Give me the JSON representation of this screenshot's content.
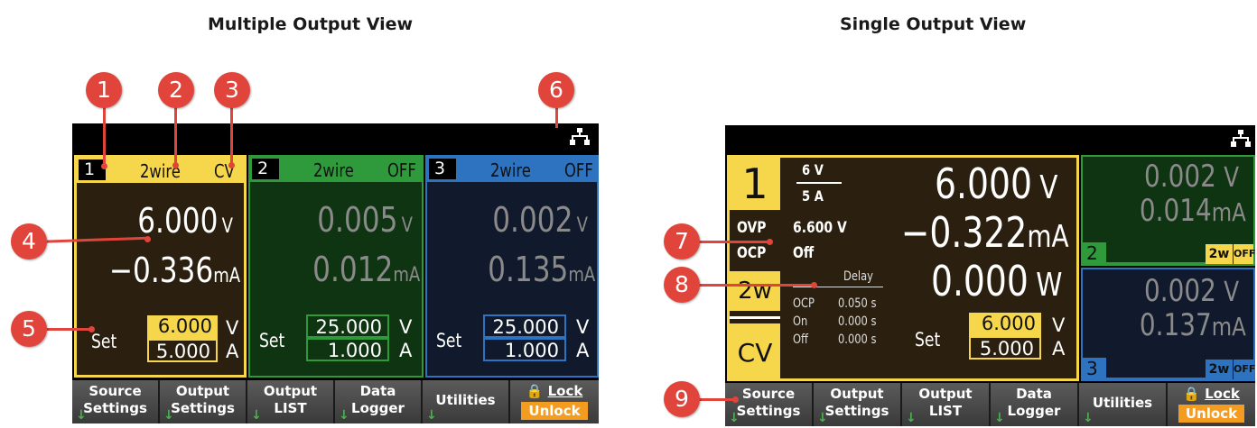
{
  "headings": {
    "multiple": "Multiple Output View",
    "single": "Single Output View"
  },
  "callouts": [
    "1",
    "2",
    "3",
    "4",
    "5",
    "6",
    "7",
    "8",
    "9"
  ],
  "colors": {
    "ch1": "#f6d64a",
    "ch2": "#2f9a3c",
    "ch3": "#2d73c0",
    "callout": "#e0443b"
  },
  "multi": {
    "ch1": {
      "num": "1",
      "wire": "2wire",
      "mode": "CV",
      "voltage": "6.000",
      "vunit": "V",
      "current": "−0.336",
      "iunit": "mA",
      "set_label": "Set",
      "set_v": "6.000",
      "set_a": "5.000",
      "vu": "V",
      "au": "A"
    },
    "ch2": {
      "num": "2",
      "wire": "2wire",
      "mode": "OFF",
      "voltage": "0.005",
      "vunit": "V",
      "current": "0.012",
      "iunit": "mA",
      "set_label": "Set",
      "set_v": "25.000",
      "set_a": "1.000",
      "vu": "V",
      "au": "A"
    },
    "ch3": {
      "num": "3",
      "wire": "2wire",
      "mode": "OFF",
      "voltage": "0.002",
      "vunit": "V",
      "current": "0.135",
      "iunit": "mA",
      "set_label": "Set",
      "set_v": "25.000",
      "set_a": "1.000",
      "vu": "V",
      "au": "A"
    },
    "softkeys": [
      {
        "l1": "Source",
        "l2": "Settings"
      },
      {
        "l1": "Output",
        "l2": "Settings"
      },
      {
        "l1": "Output",
        "l2": "LIST"
      },
      {
        "l1": "Data",
        "l2": "Logger"
      },
      {
        "l1": "Utilities",
        "l2": ""
      },
      {
        "l1": "Lock",
        "l2": "Unlock"
      }
    ]
  },
  "single": {
    "num": "1",
    "range_v": "6 V",
    "range_a": "5 A",
    "ovp_label": "OVP",
    "ovp_value": "6.600 V",
    "ocp_label": "OCP",
    "ocp_value": "Off",
    "wire": "2w",
    "mode": "CV",
    "delay_label": "Delay",
    "delay_ocp_label": "OCP",
    "delay_ocp": "0.050 s",
    "delay_on_label": "On",
    "delay_on": "0.000 s",
    "delay_off_label": "Off",
    "delay_off": "0.000 s",
    "voltage": "6.000",
    "vunit": "V",
    "current": "−0.322",
    "iunit": "mA",
    "power": "0.000",
    "punit": "W",
    "set_label": "Set",
    "set_v": "6.000",
    "set_a": "5.000",
    "vu": "V",
    "au": "A",
    "ch2": {
      "voltage": "0.002",
      "vunit": "V",
      "current": "0.014",
      "iunit": "mA",
      "num": "2",
      "wire": "2w",
      "state": "OFF"
    },
    "ch3": {
      "voltage": "0.002",
      "vunit": "V",
      "current": "0.137",
      "iunit": "mA",
      "num": "3",
      "wire": "2w",
      "state": "OFF"
    },
    "softkeys": [
      {
        "l1": "Source",
        "l2": "Settings"
      },
      {
        "l1": "Output",
        "l2": "Settings"
      },
      {
        "l1": "Output",
        "l2": "LIST"
      },
      {
        "l1": "Data",
        "l2": "Logger"
      },
      {
        "l1": "Utilities",
        "l2": ""
      },
      {
        "l1": "Lock",
        "l2": "Unlock"
      }
    ]
  }
}
